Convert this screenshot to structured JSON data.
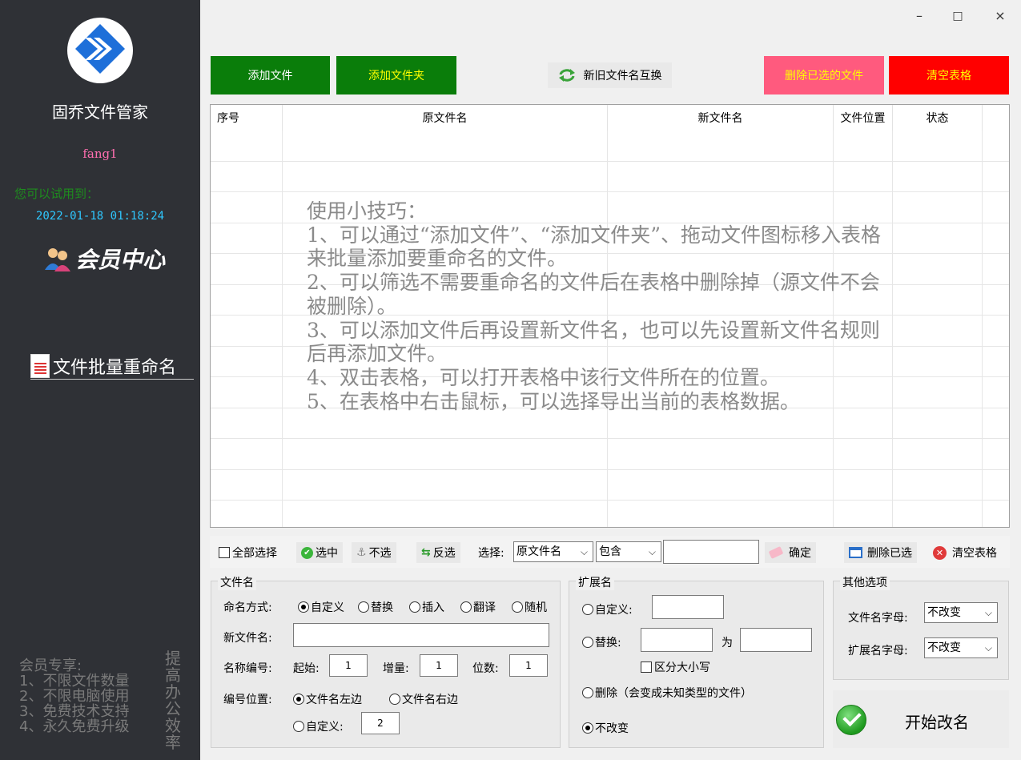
{
  "sidebar": {
    "app_name": "固乔文件管家",
    "username": "fang1",
    "trial_label": "您可以试用到：",
    "trial_date": "2022-01-18 01:18:24",
    "member_center": "会员中心",
    "menu_batch_rename": "文件批量重命名",
    "perks_title": "会员专享:",
    "perks": [
      "1、不限文件数量",
      "2、不限电脑使用",
      "3、免费技术支持",
      "4、永久免费升级"
    ],
    "slogan": [
      "提",
      "高",
      "办",
      "公",
      "效",
      "率"
    ]
  },
  "window_controls": {
    "minimize": "–",
    "maximize": "□",
    "close": "×"
  },
  "toolbar": {
    "add_file": "添加文件",
    "add_folder": "添加文件夹",
    "swap_names": "新旧文件名互换",
    "delete_selected": "删除已选的文件",
    "clear_table": "清空表格"
  },
  "colors": {
    "sidebar_bg": "#2f3136",
    "green_button": "#0a7d0a",
    "pink_button": "#ff5a7e",
    "red_button": "#ff0000",
    "yellow_text": "#ffff00"
  },
  "table": {
    "columns": [
      "序号",
      "原文件名",
      "新文件名",
      "文件位置",
      "状态"
    ],
    "tips": [
      "使用小技巧：",
      "1、可以通过“添加文件”、“添加文件夹”、拖动文件图标移入表格来批量添加要重命名的文件。",
      "2、可以筛选不需要重命名的文件后在表格中删除掉（源文件不会被删除）。",
      "3、可以添加文件后再设置新文件名，也可以先设置新文件名规则后再添加文件。",
      "4、双击表格，可以打开表格中该行文件所在的位置。",
      "5、在表格中右击鼠标，可以选择导出当前的表格数据。"
    ]
  },
  "filter_bar": {
    "select_all": "全部选择",
    "select": "选中",
    "unselect": "不选",
    "invert": "反选",
    "choose_label": "选择:",
    "field_value": "原文件名",
    "match_value": "包含",
    "confirm": "确定",
    "delete_selected": "删除已选",
    "clear_table": "清空表格"
  },
  "filename_group": {
    "title": "文件名",
    "naming_mode_label": "命名方式:",
    "modes": [
      "自定义",
      "替换",
      "插入",
      "翻译",
      "随机"
    ],
    "new_name_label": "新文件名:",
    "numbering_label": "名称编号:",
    "start_label": "起始:",
    "start_value": "1",
    "step_label": "增量:",
    "step_value": "1",
    "digits_label": "位数:",
    "digits_value": "1",
    "position_label": "编号位置:",
    "pos_left": "文件名左边",
    "pos_right": "文件名右边",
    "pos_custom": "自定义:",
    "pos_custom_value": "2"
  },
  "extension_group": {
    "title": "扩展名",
    "custom": "自定义:",
    "replace": "替换:",
    "to": "为",
    "case_sensitive": "区分大小写",
    "delete": "删除（会变成未知类型的文件）",
    "unchanged": "不改变"
  },
  "other_group": {
    "title": "其他选项",
    "filename_case_label": "文件名字母:",
    "filename_case_value": "不改变",
    "ext_case_label": "扩展名字母:",
    "ext_case_value": "不改变"
  },
  "start_button": "开始改名"
}
